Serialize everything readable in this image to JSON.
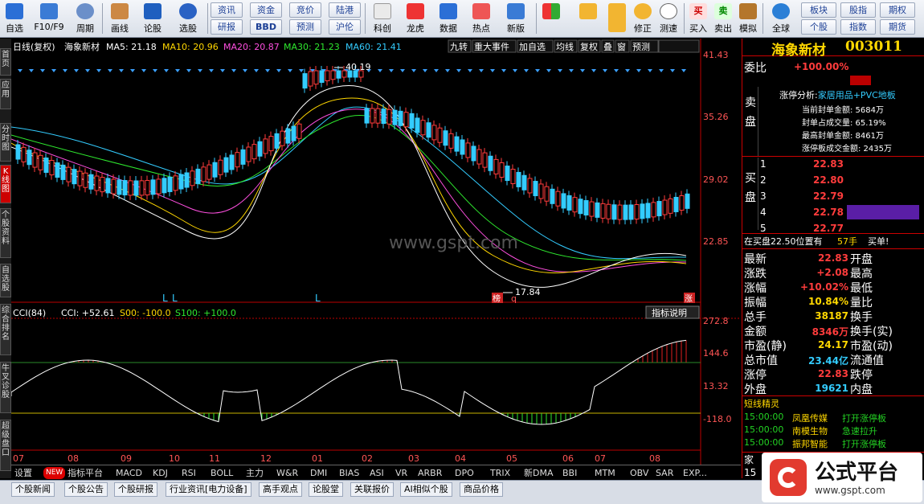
{
  "toolbar": {
    "items": [
      "自选",
      "F10/F9",
      "周期",
      "画线",
      "论股",
      "选股"
    ],
    "btns_row1": [
      "资讯",
      "资金",
      "竞价",
      "陆港"
    ],
    "btns_row2": [
      "研报",
      "BBD",
      "预测",
      "沪伦"
    ],
    "mid": [
      "科创",
      "龙虎",
      "数据",
      "热点",
      "新版"
    ],
    "right": [
      "修正",
      "测速",
      "买入",
      "卖出",
      "模拟",
      "全球"
    ],
    "far1": [
      "板块",
      "股指",
      "期权"
    ],
    "far2": [
      "个股",
      "指数",
      "期货"
    ]
  },
  "left_tabs": [
    "首页",
    "应用",
    "分时图",
    "K线图",
    "个股资料",
    "自选股",
    "综合排名",
    "牛叉诊股",
    "超级盘口"
  ],
  "chart": {
    "header": "日线(复权)",
    "stock": "海象新材",
    "ma5": "MA5: 21.18",
    "ma10": "MA10: 20.96",
    "ma20": "MA20: 20.87",
    "ma30": "MA30: 21.23",
    "ma60": "MA60: 21.41",
    "top_buttons": [
      "九转",
      "重大事件",
      "加自选",
      "均线",
      "复权",
      "叠",
      "窗",
      "预测"
    ],
    "price_labels": [
      "41.43",
      "35.26",
      "29.02",
      "22.85"
    ],
    "high_mark": "40.19",
    "low_mark": "17.84",
    "markers": [
      "L",
      "L",
      "L",
      "L",
      "榜",
      "q",
      "涨"
    ],
    "watermark": "www.gspt.com"
  },
  "indicator": {
    "title": "CCI(84)",
    "cci": "CCI: +52.61",
    "s00": "S00: -100.0",
    "s100": "S100: +100.0",
    "explain_btn": "指标说明",
    "labels": [
      "272.8",
      "144.6",
      "13.32",
      "-118.0"
    ],
    "dates": [
      "07",
      "08",
      "09",
      "10",
      "11",
      "12",
      "01",
      "02",
      "03",
      "04",
      "05",
      "06",
      "07",
      "08"
    ]
  },
  "bottom_tabs": [
    "设置",
    "NEW",
    "指标平台",
    "MACD",
    "KDJ",
    "RSI",
    "BOLL",
    "主力",
    "W&R",
    "DMI",
    "BIAS",
    "ASI",
    "VR",
    "ARBR",
    "DPO",
    "TRIX",
    "新DMA",
    "BBI",
    "MTM",
    "OBV",
    "SAR",
    "EXP..."
  ],
  "news_tabs": [
    "个股新闻",
    "个股公告",
    "个股研报",
    "行业资讯[电力设备]",
    "高手观点",
    "论股堂",
    "关联报价",
    "AI相似个股",
    "商品价格"
  ],
  "right": {
    "name": "海象新材",
    "code": "003011",
    "weibi_label": "委比",
    "weibi": "+100.00%",
    "sell_label": "卖盘",
    "buy_label": "买盘",
    "limit_title": "涨停分析:",
    "limit_sector": "家居用品+PVC地板",
    "limit_lines": [
      "当前封单金额: 5684万",
      "封单占成交量: 65.19%",
      "最高封单金额: 8461万",
      "涨停板成交金额: 2435万"
    ],
    "bids": [
      {
        "n": "1",
        "p": "22.83"
      },
      {
        "n": "2",
        "p": "22.80"
      },
      {
        "n": "3",
        "p": "22.79"
      },
      {
        "n": "4",
        "p": "22.78"
      },
      {
        "n": "5",
        "p": "22.77"
      }
    ],
    "bid_extra": "在买盘22.50位置有",
    "bid_extra2": "57手",
    "buy_single": "买单!",
    "stats": [
      {
        "l": "最新",
        "v": "22.83",
        "r": "开盘"
      },
      {
        "l": "涨跌",
        "v": "+2.08",
        "r": "最高"
      },
      {
        "l": "涨幅",
        "v": "+10.02%",
        "r": "最低"
      },
      {
        "l": "振幅",
        "v": "10.84%",
        "r": "量比"
      },
      {
        "l": "总手",
        "v": "38187",
        "r": "换手"
      },
      {
        "l": "金额",
        "v": "8346万",
        "r": "换手(实)"
      },
      {
        "l": "市盈(静)",
        "v": "24.17",
        "r": "市盈(动)"
      },
      {
        "l": "总市值",
        "v": "23.44亿",
        "r": "流通值"
      },
      {
        "l": "涨停",
        "v": "22.83",
        "r": "跌停"
      },
      {
        "l": "外盘",
        "v": "19621",
        "r": "内盘"
      }
    ],
    "short_title": "短线精灵",
    "short": [
      {
        "t": "15:00:00",
        "s": "凤凰传媒",
        "e": "打开涨停板"
      },
      {
        "t": "15:00:00",
        "s": "南模生物",
        "e": "急速拉升"
      },
      {
        "t": "15:00:00",
        "s": "振邦智能",
        "e": "打开涨停板"
      }
    ],
    "foot": "家",
    "foot2": "15"
  },
  "logo": {
    "text": "公式平台",
    "url": "www.gspt.com"
  }
}
